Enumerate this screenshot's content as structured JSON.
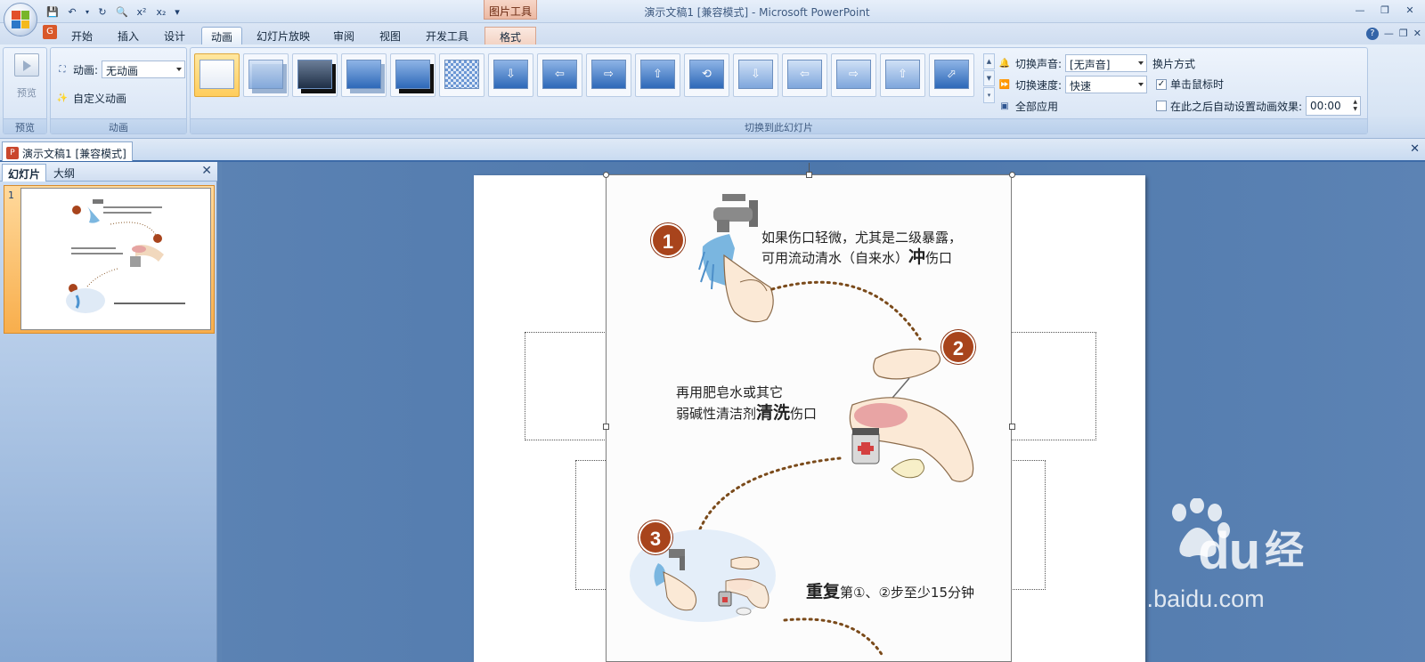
{
  "window": {
    "title": "演示文稿1 [兼容模式] - Microsoft PowerPoint",
    "context_tab_group": "图片工具"
  },
  "quick_access": {
    "superscript": "x²",
    "subscript": "x₂"
  },
  "ribbon_tabs": [
    "开始",
    "插入",
    "设计",
    "动画",
    "幻灯片放映",
    "审阅",
    "视图",
    "开发工具",
    "格式"
  ],
  "active_tab": "动画",
  "groups": {
    "preview": {
      "button_label": "预览",
      "group_label": "预览"
    },
    "animation": {
      "anim_label": "动画:",
      "anim_value": "无动画",
      "custom_label": "自定义动画",
      "group_label": "动画"
    },
    "transition": {
      "group_label": "切换到此幻灯片"
    },
    "sound": {
      "sound_label": "切换声音:",
      "sound_value": "[无声音]",
      "speed_label": "切换速度:",
      "speed_value": "快速",
      "apply_all_label": "全部应用"
    },
    "advance": {
      "title": "换片方式",
      "on_click_label": "单击鼠标时",
      "on_click_checked": true,
      "auto_label": "在此之后自动设置动画效果:",
      "auto_checked": false,
      "auto_time": "00:00"
    }
  },
  "document_tab": "演示文稿1 [兼容模式]",
  "left_pane": {
    "tabs": [
      "幻灯片",
      "大纲"
    ],
    "slide_number": "1"
  },
  "slide_content": {
    "step1": "1",
    "step1_line1": "如果伤口轻微，尤其是二级暴露，",
    "step1_line2a": "可用流动清水（自来水）",
    "step1_bold": "冲",
    "step1_line2b": "伤口",
    "step2": "2",
    "step2_line1": "再用肥皂水或其它",
    "step2_line2a": "弱碱性清洁剂",
    "step2_bold": "清洗",
    "step2_line2b": "伤口",
    "step3": "3",
    "step3_bold": "重复",
    "step3_rest": "第①、②步至少15分钟"
  },
  "watermark": {
    "brand": "Bai",
    "brand2": "du",
    "product": "经验",
    "url": "jingyan.baidu.com"
  },
  "colors": {
    "badge": "#a8441c",
    "selected_thumb": "#ffcd5c",
    "stage": "#4d77ab"
  }
}
